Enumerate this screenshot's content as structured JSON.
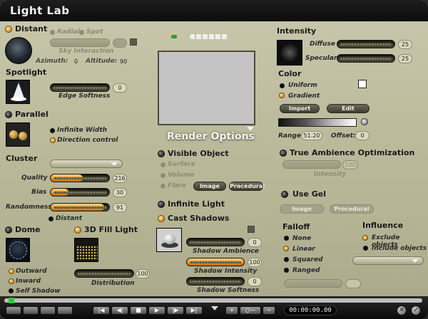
{
  "window": {
    "title": "Light  Lab"
  },
  "distant": {
    "label": "Distant",
    "radial": "Radial",
    "spot": "Spot",
    "sky_interaction": "Sky Interaction",
    "azimuth_label": "Azimuth:",
    "azimuth": "0",
    "altitude_label": "Altitude:",
    "altitude": "90"
  },
  "spotlight": {
    "label": "Spotlight",
    "edge_softness_label": "Edge Softness",
    "edge_softness": "0"
  },
  "parallel": {
    "label": "Parallel",
    "infinite_width": "Infinite Width",
    "direction_control": "Direction control"
  },
  "cluster": {
    "label": "Cluster",
    "quality_label": "Quality",
    "quality": "216",
    "quality_fill": 0.55,
    "bias_label": "Bias",
    "bias": "30",
    "bias_fill": 0.3,
    "randomness_label": "Randomness",
    "randomness": "91",
    "randomness_fill": 0.92,
    "distant": "Distant"
  },
  "dome": {
    "label": "Dome",
    "outward": "Outward",
    "inward": "Inward",
    "self_shadow": "Self Shadow"
  },
  "fill3d": {
    "label": "3D Fill Light",
    "distribution_label": "Distribution",
    "distribution": "100"
  },
  "render": {
    "title": "Render Options",
    "visible_object": "Visible Object",
    "surface": "Surface",
    "volume": "Volume",
    "flare": "Flare",
    "image_btn": "Image",
    "procedural_btn": "Procedural",
    "infinite_light": "Infinite Light",
    "cast_shadows": "Cast Shadows",
    "shadow_ambience_label": "Shadow Ambience",
    "shadow_ambience": "0",
    "shadow_intensity_label": "Shadow Intensity",
    "shadow_intensity": "100",
    "shadow_intensity_fill": 1.0,
    "shadow_softness_label": "Shadow Softness",
    "shadow_softness": "0"
  },
  "intensity": {
    "label": "Intensity",
    "diffuse_label": "Diffuse",
    "diffuse": "25",
    "specular_label": "Specular",
    "specular": "25"
  },
  "color": {
    "label": "Color",
    "uniform": "Uniform",
    "gradient": "Gradient",
    "import_btn": "Import",
    "edit_btn": "Edit",
    "range_label": "Range:",
    "range": "51.20",
    "offset_label": "Offset:",
    "offset": "0"
  },
  "ambience": {
    "label": "True Ambience Optimization",
    "intensity_label": "Intensity",
    "intensity": "100"
  },
  "gel": {
    "label": "Use Gel",
    "image_btn": "Image",
    "procedural_btn": "Procedural"
  },
  "falloff": {
    "label": "Falloff",
    "none": "None",
    "linear": "Linear",
    "squared": "Squared",
    "ranged": "Ranged"
  },
  "influence": {
    "label": "Influence",
    "exclude": "Exclude objects",
    "include": "Include objects"
  },
  "timeline": {
    "timecode": "00:00:00.00"
  },
  "colors": {
    "accent": "#ee8f1c",
    "panel": "#bcbb9c",
    "titlebar": "#111111"
  }
}
